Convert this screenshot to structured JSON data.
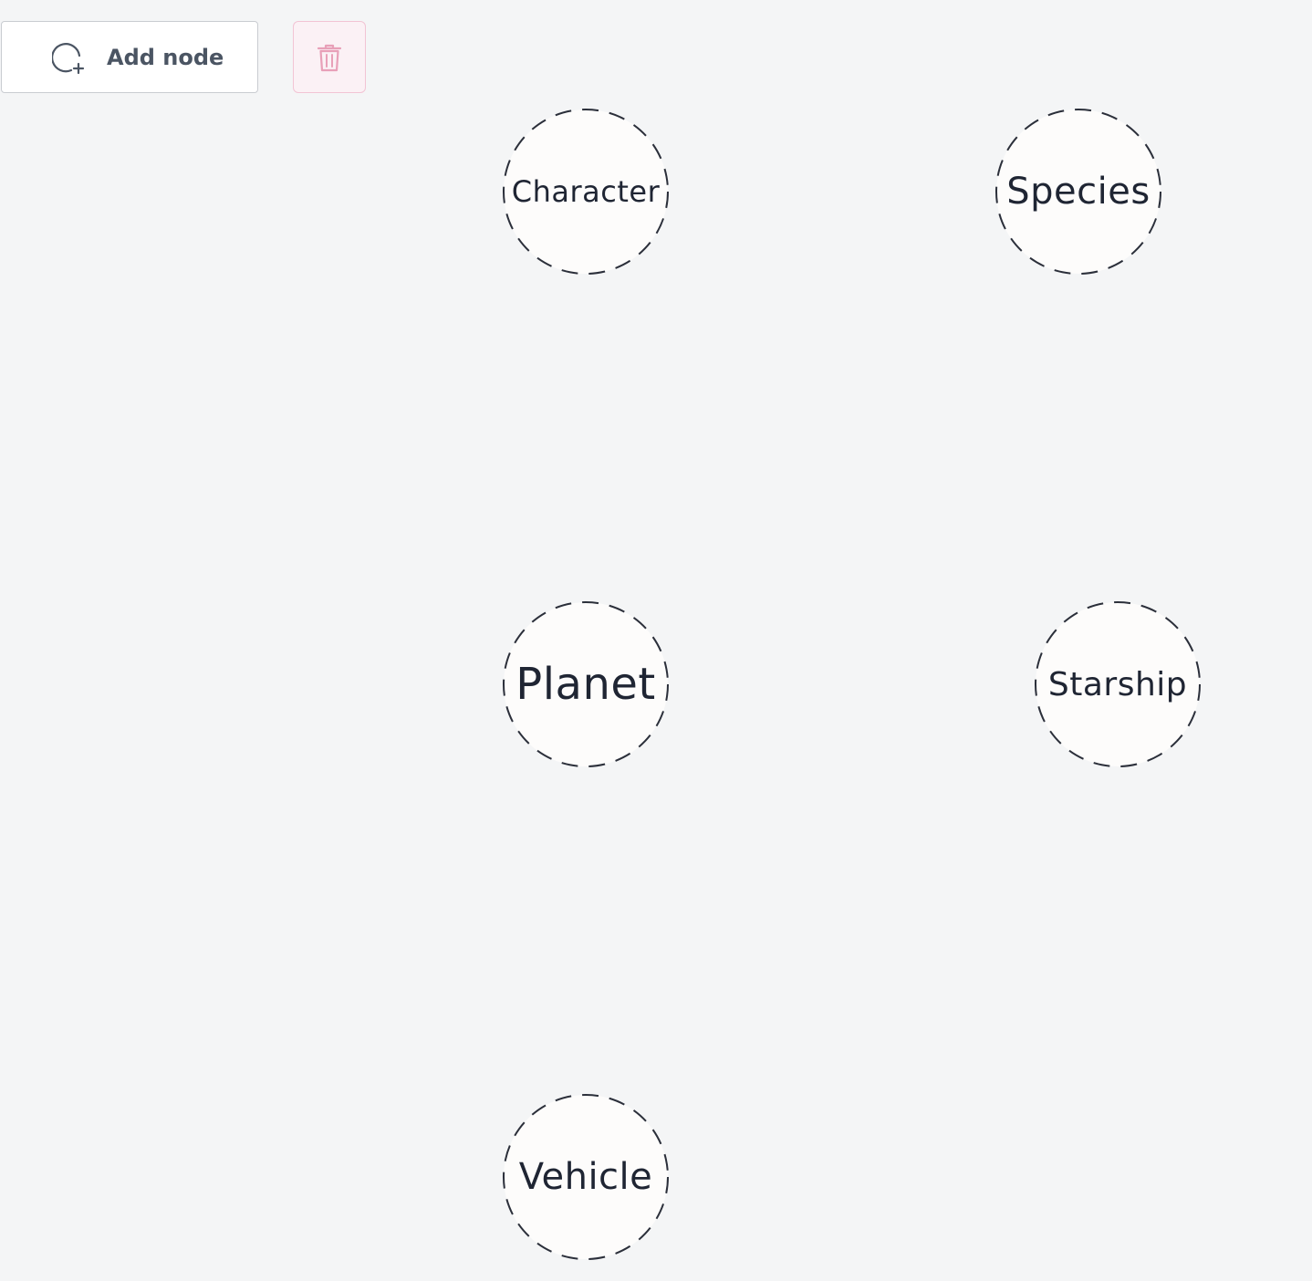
{
  "toolbar": {
    "add_node_label": "Add node",
    "add_node_icon": "circle-plus-icon",
    "delete_icon": "trash-icon"
  },
  "graph": {
    "nodes": [
      {
        "label": "Character"
      },
      {
        "label": "Species"
      },
      {
        "label": "Planet"
      },
      {
        "label": "Starship"
      },
      {
        "label": "Vehicle"
      }
    ]
  },
  "colors": {
    "background": "#f4f5f6",
    "node_fill": "#fdfcfb",
    "node_border": "#2b2f3a",
    "node_text": "#1f2533",
    "delete_accent": "#e8a0b8",
    "button_text": "#4b5563"
  }
}
